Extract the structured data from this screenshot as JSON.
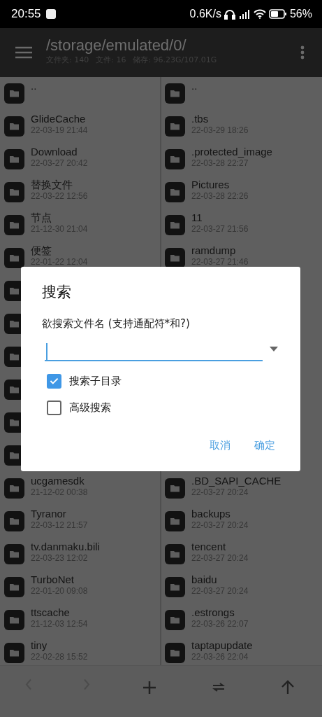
{
  "status_bar": {
    "time": "20:55",
    "net_speed": "0.6K/s",
    "battery": "56%"
  },
  "toolbar": {
    "path": "/storage/emulated/0/",
    "stats": [
      "文件夹: 140",
      "文件: 16",
      "储存: 96.23G/107.01G"
    ]
  },
  "panes": [
    {
      "rows": [
        {
          "kind": "folder",
          "name": ".."
        },
        {
          "kind": "folder",
          "name": "GlideCache",
          "date": "22-03-19 21:44"
        },
        {
          "kind": "folder",
          "name": "Download",
          "date": "22-03-27 20:42"
        },
        {
          "kind": "folder",
          "name": "替换文件",
          "date": "22-03-22 12:56"
        },
        {
          "kind": "folder",
          "name": "节点",
          "date": "21-12-30 21:04"
        },
        {
          "kind": "folder",
          "name": "便签",
          "date": "22-01-22 12:04"
        },
        {
          "kind": "covered"
        },
        {
          "kind": "covered"
        },
        {
          "kind": "covered"
        },
        {
          "kind": "covered"
        },
        {
          "kind": "covered"
        },
        {
          "kind": "covered"
        },
        {
          "kind": "folder",
          "name": "ucgamesdk",
          "date": "21-12-02 00:38"
        },
        {
          "kind": "folder",
          "name": "Tyranor",
          "date": "22-03-12 21:57"
        },
        {
          "kind": "folder",
          "name": "tv.danmaku.bili",
          "date": "22-03-23 12:02"
        },
        {
          "kind": "folder",
          "name": "TurboNet",
          "date": "22-01-20 09:08"
        },
        {
          "kind": "folder",
          "name": "ttscache",
          "date": "21-12-03 12:54"
        },
        {
          "kind": "folder",
          "name": "tiny",
          "date": "22-02-28 15:52"
        }
      ]
    },
    {
      "rows": [
        {
          "kind": "folder",
          "name": ".."
        },
        {
          "kind": "folder",
          "name": ".tbs",
          "date": "22-03-29 18:26"
        },
        {
          "kind": "folder",
          "name": ".protected_image",
          "date": "22-03-28 22:27"
        },
        {
          "kind": "folder",
          "name": "Pictures",
          "date": "22-03-28 22:26"
        },
        {
          "kind": "folder",
          "name": "11",
          "date": "22-03-27 21:56"
        },
        {
          "kind": "folder",
          "name": "ramdump",
          "date": "22-03-27 21:46"
        },
        {
          "kind": "gap"
        },
        {
          "kind": "gap"
        },
        {
          "kind": "gap"
        },
        {
          "kind": "gap"
        },
        {
          "kind": "gap"
        },
        {
          "kind": "gap"
        },
        {
          "kind": "folder",
          "name": ".BD_SAPI_CACHE",
          "date": "22-03-27 20:24"
        },
        {
          "kind": "folder",
          "name": "backups",
          "date": "22-03-27 20:24"
        },
        {
          "kind": "folder",
          "name": "tencent",
          "date": "22-03-27 20:24"
        },
        {
          "kind": "folder",
          "name": "baidu",
          "date": "22-03-27 20:24"
        },
        {
          "kind": "folder",
          "name": ".estrongs",
          "date": "22-03-26 22:07"
        },
        {
          "kind": "folder",
          "name": "taptapupdate",
          "date": "22-03-26 22:04"
        }
      ]
    }
  ],
  "bottom_bar": [
    {
      "kind": "back",
      "disabled": true
    },
    {
      "kind": "forward",
      "disabled": true
    },
    {
      "kind": "add",
      "disabled": false
    },
    {
      "kind": "swap",
      "disabled": false
    },
    {
      "kind": "up",
      "disabled": false
    }
  ],
  "dialog": {
    "title": "搜索",
    "label": "欲搜索文件名 (支持通配符*和?)",
    "options": [
      {
        "label": "搜索子目录",
        "checked": true
      },
      {
        "label": "高级搜索",
        "checked": false
      }
    ],
    "buttons": [
      "取消",
      "确定"
    ]
  }
}
